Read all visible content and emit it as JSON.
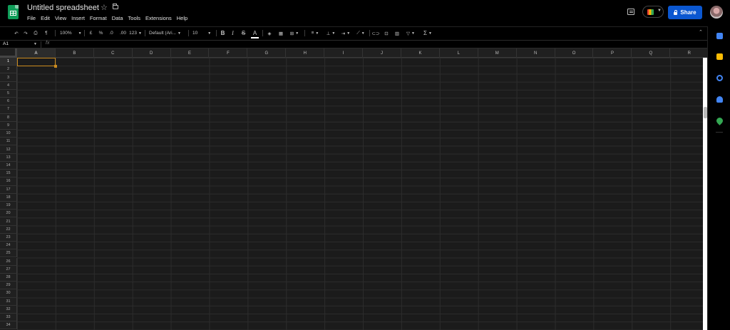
{
  "header": {
    "title": "Untitled spreadsheet",
    "menu": [
      "File",
      "Edit",
      "View",
      "Insert",
      "Format",
      "Data",
      "Tools",
      "Extensions",
      "Help"
    ],
    "share_label": "Share"
  },
  "toolbar": {
    "zoom": "100%",
    "currency": "£",
    "percent": "%",
    "decrease_decimal": ".0",
    "increase_decimal": ".00",
    "more_formats": "123",
    "font": "Default (Ari...",
    "font_size": "10",
    "bold": "B",
    "italic": "I",
    "strike": "S",
    "text_color": "A",
    "functions": "Σ"
  },
  "formula_bar": {
    "cell_ref": "A1",
    "fx": "fx"
  },
  "grid": {
    "columns": [
      "A",
      "B",
      "C",
      "D",
      "E",
      "F",
      "G",
      "H",
      "I",
      "J",
      "K",
      "L",
      "M",
      "N",
      "O",
      "P",
      "Q",
      "R"
    ],
    "rows": [
      "1",
      "2",
      "3",
      "4",
      "5",
      "6",
      "7",
      "8",
      "9",
      "10",
      "11",
      "12",
      "13",
      "14",
      "15",
      "16",
      "17",
      "18",
      "19",
      "20",
      "21",
      "22",
      "23",
      "24",
      "25",
      "26",
      "27",
      "28",
      "29",
      "30",
      "31",
      "32",
      "33",
      "34"
    ],
    "active_cell": "A1"
  },
  "side_panel": {
    "icons": [
      {
        "name": "calendar-icon",
        "color": "#4285f4"
      },
      {
        "name": "keep-icon",
        "color": "#fbbc04"
      },
      {
        "name": "tasks-icon",
        "color": "#4285f4"
      },
      {
        "name": "contacts-icon",
        "color": "#4285f4"
      },
      {
        "name": "maps-icon",
        "color": "#34a853"
      }
    ]
  },
  "colors": {
    "accent": "#0b57d0",
    "selection": "#c98a1e",
    "brand": "#0f9d58"
  }
}
